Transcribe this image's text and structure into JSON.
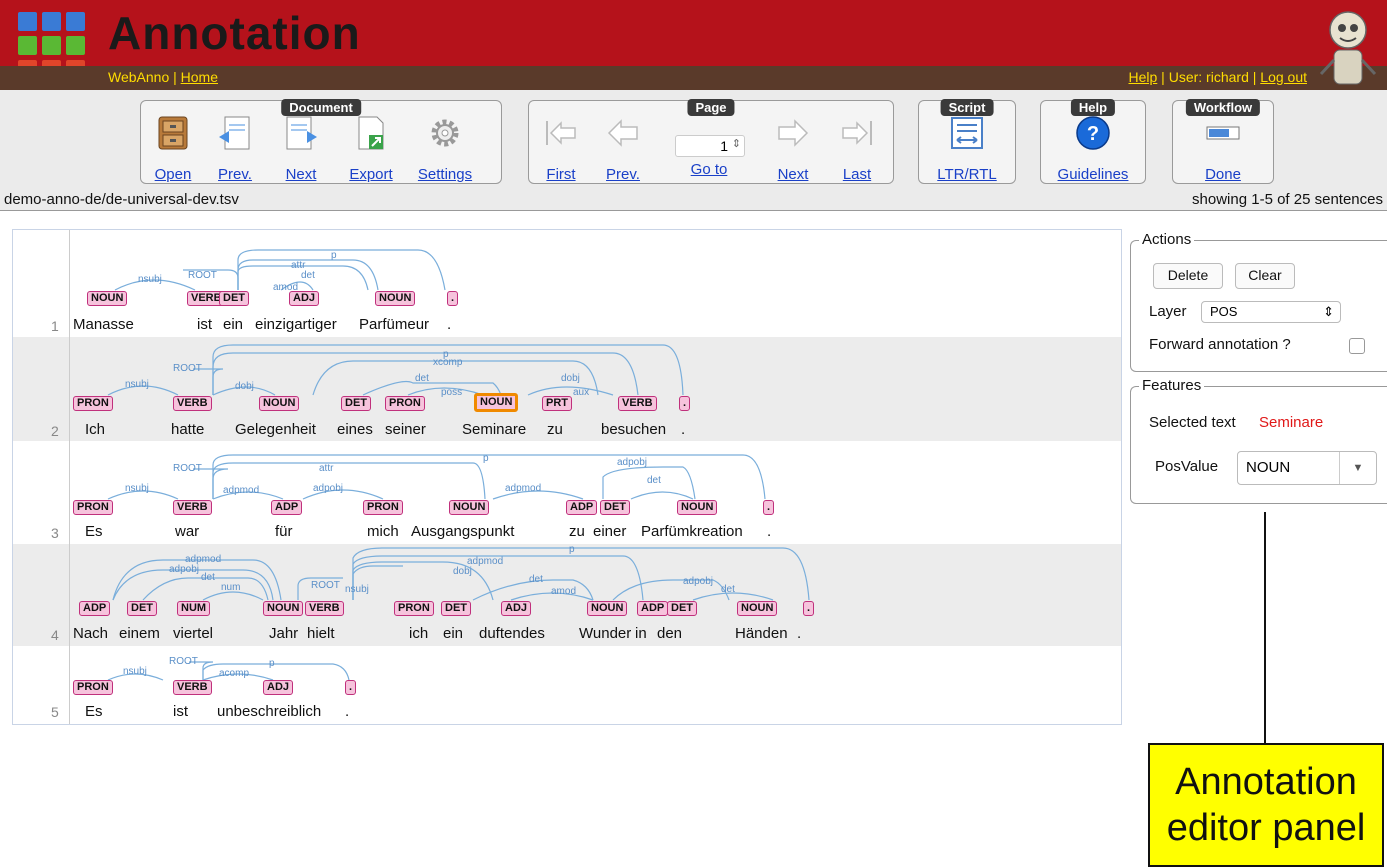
{
  "header": {
    "title": "Annotation",
    "links_left": [
      "WebAnno",
      "Home"
    ],
    "help": "Help",
    "user": "User: richard",
    "logout": "Log out"
  },
  "toolbar": {
    "document": {
      "title": "Document",
      "open": "Open",
      "prev": "Prev.",
      "next": "Next",
      "export": "Export",
      "settings": "Settings"
    },
    "page": {
      "title": "Page",
      "first": "First",
      "prev": "Prev.",
      "goto": "Go to",
      "next": "Next",
      "last": "Last",
      "page_value": "1"
    },
    "script": {
      "title": "Script",
      "ltr_rtl": "LTR/RTL"
    },
    "help": {
      "title": "Help",
      "guidelines": "Guidelines"
    },
    "workflow": {
      "title": "Workflow",
      "done": "Done"
    }
  },
  "file_path": "demo-anno-de/de-universal-dev.tsv",
  "showing": "showing 1-5 of 25 sentences",
  "sentences": [
    {
      "num": "1",
      "tokens": [
        "Manasse",
        "ist",
        "ein",
        "einzigartiger",
        "Parfümeur",
        "."
      ],
      "tags": [
        "NOUN",
        "VERB",
        "DET",
        "ADJ",
        "NOUN",
        "."
      ],
      "arcs": [
        "nsubj",
        "ROOT",
        "attr",
        "det",
        "amod",
        "p"
      ]
    },
    {
      "num": "2",
      "tokens": [
        "Ich",
        "hatte",
        "Gelegenheit",
        "eines",
        "seiner",
        "Seminare",
        "zu",
        "besuchen",
        "."
      ],
      "tags": [
        "PRON",
        "VERB",
        "NOUN",
        "DET",
        "PRON",
        "NOUN",
        "PRT",
        "VERB",
        "."
      ],
      "arcs": [
        "nsubj",
        "ROOT",
        "dobj",
        "det",
        "poss",
        "xcomp",
        "dobj",
        "aux",
        "p"
      ]
    },
    {
      "num": "3",
      "tokens": [
        "Es",
        "war",
        "für",
        "mich",
        "Ausgangspunkt",
        "zu",
        "einer",
        "Parfümkreation",
        "."
      ],
      "tags": [
        "PRON",
        "VERB",
        "ADP",
        "PRON",
        "NOUN",
        "ADP",
        "DET",
        "NOUN",
        "."
      ],
      "arcs": [
        "nsubj",
        "ROOT",
        "adpmod",
        "adpobj",
        "attr",
        "adpmod",
        "adpobj",
        "det",
        "p"
      ]
    },
    {
      "num": "4",
      "tokens": [
        "Nach",
        "einem",
        "viertel",
        "Jahr",
        "hielt",
        "ich",
        "ein",
        "duftendes",
        "Wunder",
        "in",
        "den",
        "Händen",
        "."
      ],
      "tags": [
        "ADP",
        "DET",
        "NUM",
        "NOUN",
        "VERB",
        "PRON",
        "DET",
        "ADJ",
        "NOUN",
        "ADP",
        "DET",
        "NOUN",
        "."
      ],
      "arcs": [
        "adpmod",
        "adpobj",
        "det",
        "num",
        "ROOT",
        "nsubj",
        "dobj",
        "det",
        "amod",
        "adpmod",
        "adpobj",
        "det",
        "p"
      ]
    },
    {
      "num": "5",
      "tokens": [
        "Es",
        "ist",
        "unbeschreiblich",
        "."
      ],
      "tags": [
        "PRON",
        "VERB",
        "ADJ",
        "."
      ],
      "arcs": [
        "nsubj",
        "ROOT",
        "acomp",
        "p"
      ]
    }
  ],
  "panel": {
    "actions_legend": "Actions",
    "delete": "Delete",
    "clear": "Clear",
    "layer_label": "Layer",
    "layer_value": "POS",
    "forward_label": "Forward annotation ?",
    "features_legend": "Features",
    "selected_label": "Selected text",
    "selected_value": "Seminare",
    "posvalue_label": "PosValue",
    "posvalue_value": "NOUN"
  },
  "callout": "Annotation editor panel",
  "colors": {
    "header": "#b5121b",
    "tag_fill": "#f6c3dc",
    "tag_border": "#c0307c",
    "arc": "#7aaedb",
    "selection": "#f08a00",
    "callout": "#ffff00"
  }
}
